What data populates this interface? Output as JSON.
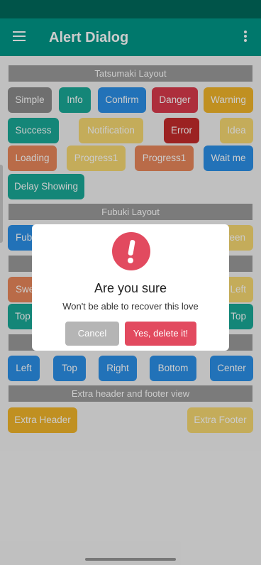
{
  "app": {
    "title": "Alert Dialog"
  },
  "sections": {
    "tatsumaki": "Tatsumaki Layout",
    "fubuki": "Fubuki Layout",
    "extra": "Extra header and footer view"
  },
  "buttons": {
    "simple": "Simple",
    "info": "Info",
    "confirm": "Confirm",
    "danger": "Danger",
    "warning": "Warning",
    "success": "Success",
    "notification": "Notification",
    "error": "Error",
    "idea": "Idea",
    "loading": "Loading",
    "progress1a": "Progress1",
    "progress1b": "Progress1",
    "wait": "Wait me",
    "delay": "Delay Showing",
    "fub_left": "Fub",
    "fub_right": "reen",
    "swe_left": "Swe",
    "swe_right": "Left",
    "top_left": "Top",
    "top_right": "Top",
    "left": "Left",
    "top": "Top",
    "right": "Right",
    "bottom": "Bottom",
    "center": "Center",
    "extra_header": "Extra Header",
    "extra_footer": "Extra Footer"
  },
  "dialog": {
    "title": "Are you sure",
    "message": "Won't be able to recover this love",
    "cancel": "Cancel",
    "confirm": "Yes, delete it!"
  },
  "colors": {
    "gray": "#8b8b8b",
    "teal": "#1aa896",
    "blue": "#2b8fe6",
    "red": "#d93a4c",
    "yellow": "#f0b42a",
    "orange": "#e8865a",
    "darkred": "#c32b2b",
    "cream": "#f5d871"
  }
}
